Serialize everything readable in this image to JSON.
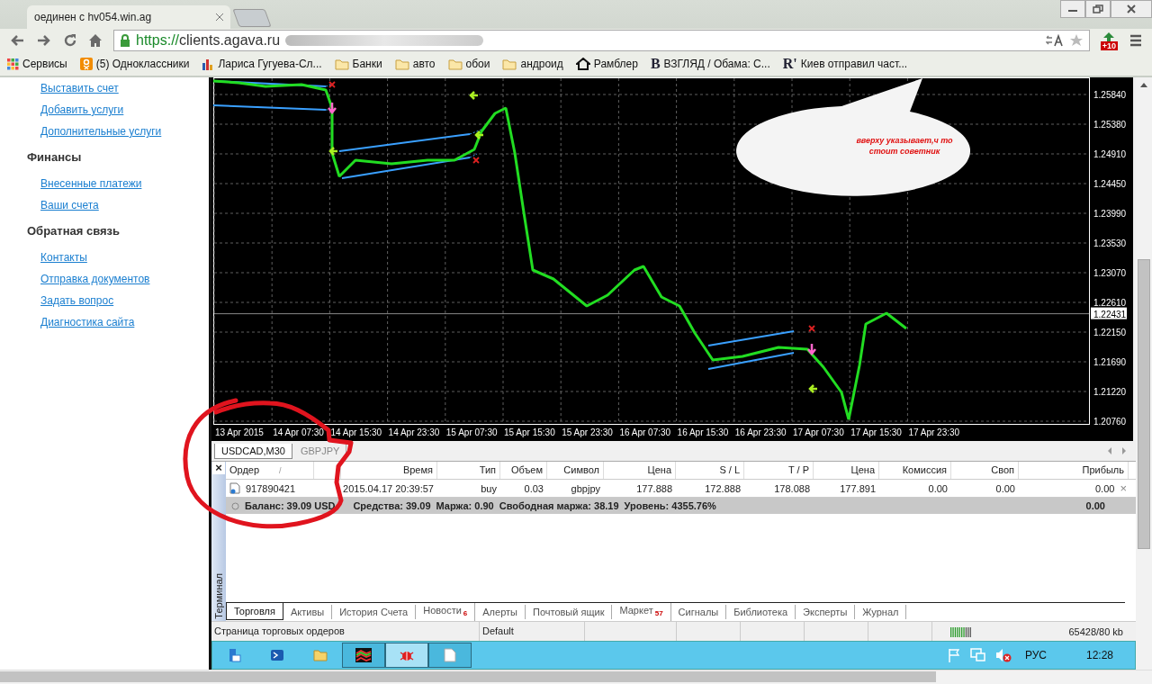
{
  "browser": {
    "tab_title": "оединен с hv054.win.ag",
    "url_scheme": "https://",
    "url_host": "clients.agava.ru",
    "extension_badge": "+10",
    "bookmarks": [
      {
        "kind": "apps",
        "label": "Сервисы"
      },
      {
        "kind": "ok",
        "label": "(5) Одноклассники"
      },
      {
        "kind": "chart",
        "label": "Лариса Гугуева-Сл..."
      },
      {
        "kind": "folder",
        "label": "Банки"
      },
      {
        "kind": "folder",
        "label": "авто"
      },
      {
        "kind": "folder",
        "label": "обои"
      },
      {
        "kind": "folder",
        "label": "андроид"
      },
      {
        "kind": "home",
        "label": "Рамблер"
      },
      {
        "kind": "letter",
        "glyph": "B",
        "label": "ВЗГЛЯД / Обама: С..."
      },
      {
        "kind": "letter",
        "glyph": "R'",
        "label": "Киев отправил част..."
      }
    ]
  },
  "sidebar": [
    {
      "kind": "link",
      "label": "Выставить счет"
    },
    {
      "kind": "link",
      "label": "Добавить услуги"
    },
    {
      "kind": "link",
      "label": "Дополнительные услуги"
    },
    {
      "kind": "heading",
      "label": "Финансы"
    },
    {
      "kind": "link",
      "label": "Внесенные платежи"
    },
    {
      "kind": "link",
      "label": "Ваши счета"
    },
    {
      "kind": "heading",
      "label": "Обратная связь"
    },
    {
      "kind": "link",
      "label": "Контакты"
    },
    {
      "kind": "link",
      "label": "Отправка документов"
    },
    {
      "kind": "link",
      "label": "Задать вопрос"
    },
    {
      "kind": "link",
      "label": "Диагностика сайта"
    }
  ],
  "chart": {
    "price_ticks": [
      "1.25840",
      "1.25380",
      "1.24910",
      "1.24450",
      "1.23990",
      "1.23530",
      "1.23070",
      "1.22610",
      "1.22150",
      "1.21690",
      "1.21220",
      "1.20760"
    ],
    "current_price": "1.22431",
    "time_ticks": [
      "13 Apr 2015",
      "14 Apr 07:30",
      "14 Apr 15:30",
      "14 Apr 23:30",
      "15 Apr 07:30",
      "15 Apr 15:30",
      "15 Apr 23:30",
      "16 Apr 07:30",
      "16 Apr 15:30",
      "16 Apr 23:30",
      "17 Apr 07:30",
      "17 Apr 15:30",
      "17 Apr 23:30"
    ],
    "callout": "вверху указывает,ч то\nстоит советник"
  },
  "chart_tabs": [
    {
      "label": "USDCAD,M30",
      "selected": true
    },
    {
      "label": "GBPJPY",
      "selected": false
    }
  ],
  "terminal": {
    "close": "×",
    "side_label": "Терминал",
    "sort_mark": "/",
    "columns": [
      "Ордер",
      "",
      "Время",
      "Тип",
      "Объем",
      "Символ",
      "Цена",
      "S / L",
      "T / P",
      "Цена",
      "Комиссия",
      "Своп",
      "Прибыль"
    ],
    "rows": [
      {
        "cells": [
          "917890421",
          "",
          "2015.04.17 20:39:57",
          "buy",
          "0.03",
          "gbpjpy",
          "177.888",
          "172.888",
          "178.088",
          "177.891",
          "0.00",
          "0.00",
          "0.00"
        ],
        "close": "×"
      }
    ],
    "balance": [
      "Баланс: 39.09 USD",
      "Средства: 39.09",
      "Маржа: 0.90",
      "Свободная маржа: 38.19",
      "Уровень: 4355.76%"
    ],
    "balance_profit": "0.00",
    "tabs": [
      {
        "label": "Торговля",
        "selected": true
      },
      {
        "label": "Активы",
        "selected": false
      },
      {
        "label": "История Счета",
        "selected": false
      },
      {
        "label": "Новости",
        "badge": "6",
        "selected": false
      },
      {
        "label": "Алерты",
        "selected": false
      },
      {
        "label": "Почтовый ящик",
        "selected": false
      },
      {
        "label": "Маркет",
        "badge": "57",
        "selected": false
      },
      {
        "label": "Сигналы",
        "selected": false
      },
      {
        "label": "Библиотека",
        "selected": false
      },
      {
        "label": "Эксперты",
        "selected": false
      },
      {
        "label": "Журнал",
        "selected": false
      }
    ]
  },
  "status_bar": {
    "hint": "Страница торговых ордеров",
    "profile": "Default",
    "traffic": "65428/80 kb"
  },
  "taskbar": {
    "buttons": [
      {
        "kind": "server",
        "selected": false
      },
      {
        "kind": "terminal",
        "selected": false
      },
      {
        "kind": "folder",
        "selected": false
      },
      {
        "kind": "chart",
        "selected": false
      },
      {
        "kind": "bug",
        "selected": true
      },
      {
        "kind": "file",
        "selected": false
      }
    ],
    "language": "РУС",
    "time": "12:28"
  }
}
